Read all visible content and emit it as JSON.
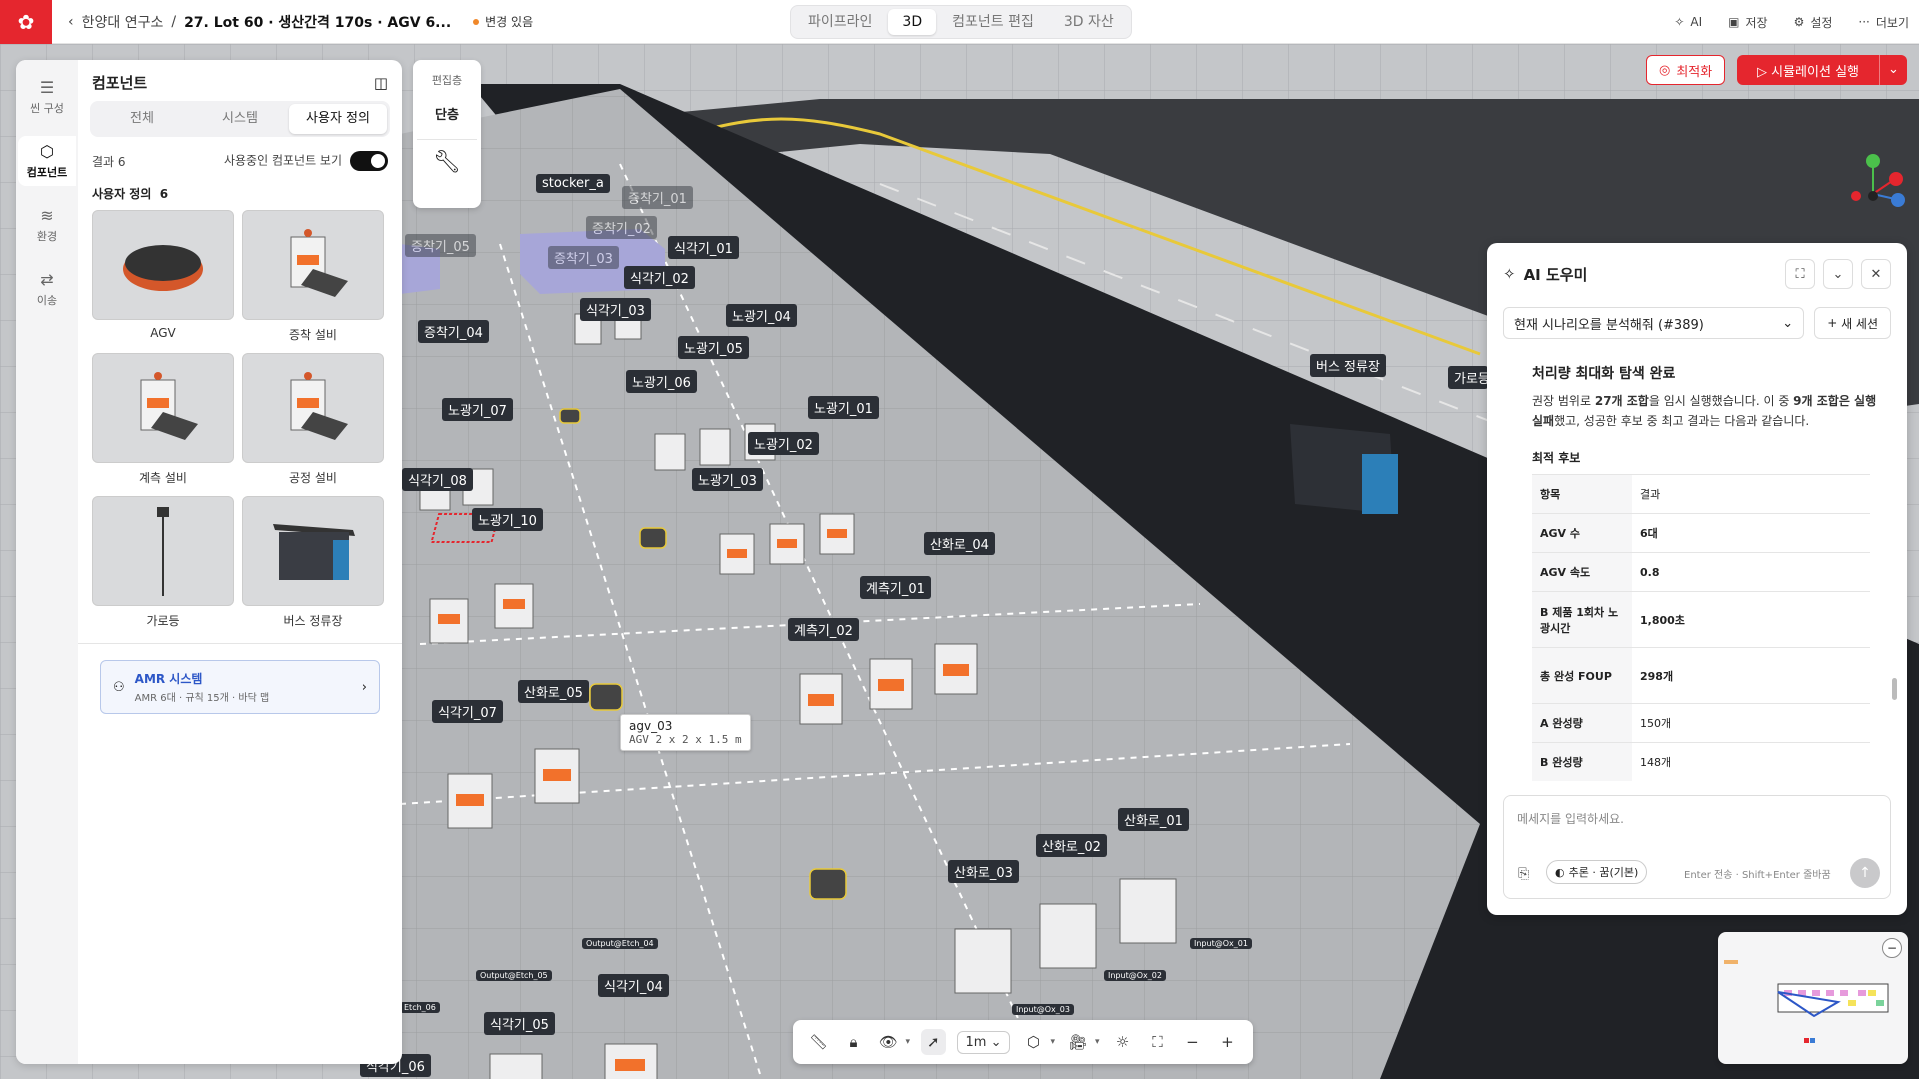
{
  "topbar": {
    "breadcrumb_parent": "한양대 연구소",
    "breadcrumb_sep": "/",
    "breadcrumb_current": "27. Lot 60 · 생산간격 170s · AGV 6...",
    "unsaved": "변경 있음",
    "modes": [
      "파이프라인",
      "3D",
      "컴포넌트 편집",
      "3D 자산"
    ],
    "active_mode": "3D",
    "actions": {
      "ai": "AI",
      "save": "저장",
      "settings": "설정",
      "more": "더보기"
    }
  },
  "rail": {
    "items": [
      {
        "label": "씬 구성",
        "icon": "list-icon"
      },
      {
        "label": "컴포넌트",
        "icon": "cube-icon"
      },
      {
        "label": "환경",
        "icon": "layers-icon"
      },
      {
        "label": "이송",
        "icon": "route-icon"
      }
    ]
  },
  "panel": {
    "title": "컴포넌트",
    "tabs": [
      "전체",
      "시스템",
      "사용자 정의"
    ],
    "result_count": "결과 6",
    "show_used_label": "사용중인 컴포넌트 보기",
    "section_label": "사용자 정의",
    "section_count": "6",
    "components": [
      "AGV",
      "증착 설비",
      "계측 설비",
      "공정 설비",
      "가로등",
      "버스 정류장"
    ],
    "amr": {
      "title": "AMR 시스템",
      "sub": "AMR 6대 · 규칙 15개 · 바닥 맵"
    }
  },
  "editlayer": {
    "title": "편집층",
    "value": "단층"
  },
  "buttons": {
    "optimize": "최적화",
    "run": "시뮬레이션 실행"
  },
  "ai": {
    "title": "AI 도우미",
    "session": "현재 시나리오를 분석해줘 (#389)",
    "new_session": "새 세션",
    "heading": "처리량 최대화 탐색 완료",
    "para_1": "권장 범위로 ",
    "para_b1": "27개 조합",
    "para_2": "을 임시 실행했습니다. 이 중 ",
    "para_b2": "9개 조합은 실행 실패",
    "para_3": "했고, 성공한 후보 중 최고 결과는 다음과 같습니다.",
    "best_label": "최적 후보",
    "table": [
      {
        "k": "항목",
        "v": "결과",
        "bold": false
      },
      {
        "k": "AGV 수",
        "v": "6대",
        "bold": true
      },
      {
        "k": "AGV 속도",
        "v": "0.8",
        "bold": true
      },
      {
        "k": "B 제품 1회차 노광시간",
        "v": "1,800초",
        "bold": true
      },
      {
        "k": "총 완성 FOUP",
        "v": "298개",
        "bold": true
      },
      {
        "k": "A 완성량",
        "v": "150개",
        "bold": false
      },
      {
        "k": "B 완성량",
        "v": "148개",
        "bold": false
      }
    ],
    "input_placeholder": "메세지를 입력하세요.",
    "mode": "추론 · 꿈(기본)",
    "hint": "Enter 전송 · Shift+Enter 줄바꿈"
  },
  "toolbar": {
    "scale": "1m"
  },
  "scene": {
    "tooltip_name": "agv_03",
    "tooltip_sub": "AGV 2 x 2 x 1.5 m",
    "labels": [
      {
        "t": "stocker_a",
        "c": ""
      },
      {
        "t": "증착기_01",
        "c": "dim"
      },
      {
        "t": "증착기_02",
        "c": "dim"
      },
      {
        "t": "증착기_03",
        "c": "dim"
      },
      {
        "t": "증착기_05",
        "c": "dim"
      },
      {
        "t": "식각기_01",
        "c": ""
      },
      {
        "t": "식각기_02",
        "c": ""
      },
      {
        "t": "식각기_03",
        "c": ""
      },
      {
        "t": "노광기_04",
        "c": ""
      },
      {
        "t": "노광기_05",
        "c": ""
      },
      {
        "t": "증착기_04",
        "c": ""
      },
      {
        "t": "노광기_06",
        "c": ""
      },
      {
        "t": "노광기_07",
        "c": ""
      },
      {
        "t": "노광기_01",
        "c": ""
      },
      {
        "t": "노광기_02",
        "c": ""
      },
      {
        "t": "노광기_03",
        "c": ""
      },
      {
        "t": "식각기_08",
        "c": ""
      },
      {
        "t": "노광기_10",
        "c": ""
      },
      {
        "t": "산화로_04",
        "c": ""
      },
      {
        "t": "계측기_01",
        "c": ""
      },
      {
        "t": "계측기_02",
        "c": ""
      },
      {
        "t": "식각기_07",
        "c": ""
      },
      {
        "t": "산화로_05",
        "c": ""
      },
      {
        "t": "산화로_01",
        "c": ""
      },
      {
        "t": "산화로_02",
        "c": ""
      },
      {
        "t": "산화로_03",
        "c": ""
      },
      {
        "t": "식각기_04",
        "c": ""
      },
      {
        "t": "식각기_05",
        "c": ""
      },
      {
        "t": "식각기_06",
        "c": ""
      },
      {
        "t": "버스 정류장",
        "c": ""
      },
      {
        "t": "가로등",
        "c": ""
      },
      {
        "t": "Output@Etch_04",
        "c": "tiny"
      },
      {
        "t": "Output@Etch_05",
        "c": "tiny"
      },
      {
        "t": "Input@Ox_02",
        "c": "tiny"
      },
      {
        "t": "Input@Ox_01",
        "c": "tiny"
      },
      {
        "t": "Input@Ox_03",
        "c": "tiny"
      },
      {
        "t": "Etch_06",
        "c": "tiny"
      }
    ]
  },
  "colors": {
    "brand": "#e5262e",
    "accent_blue": "#2d57c7"
  }
}
